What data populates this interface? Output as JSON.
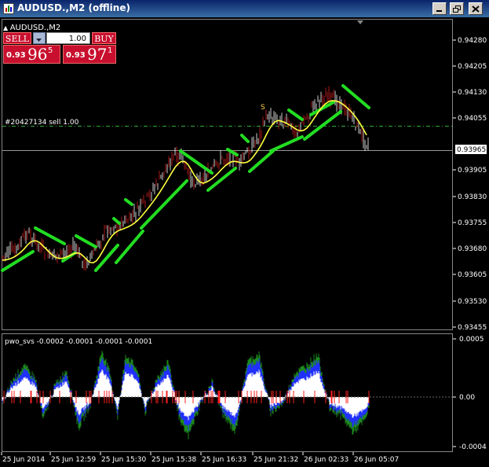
{
  "window": {
    "title": "AUDUSD.,M2 (offline)"
  },
  "chart": {
    "symbol_label": "AUDUSD.,M2",
    "order_line_label": "#20427134 sell 1.00",
    "signal_label": "S",
    "current_price": "0.93965",
    "price_axis": [
      "0.94280",
      "0.94205",
      "0.94130",
      "0.94055",
      "0.93980",
      "0.93905",
      "0.93830",
      "0.93755",
      "0.93680",
      "0.93605",
      "0.93530",
      "0.93455"
    ],
    "time_axis": [
      "25 Jun 2014",
      "25 Jun 12:59",
      "25 Jun 15:30",
      "25 Jun 15:38",
      "25 Jun 16:33",
      "25 Jun 21:32",
      "26 Jun 02:33",
      "26 Jun 05:07"
    ]
  },
  "trade_panel": {
    "sell_label": "SELL",
    "buy_label": "BUY",
    "lot_value": "1.00",
    "sell_price": {
      "prefix": "0.93",
      "big": "96",
      "sup": "5"
    },
    "buy_price": {
      "prefix": "0.93",
      "big": "97",
      "sup": "1"
    }
  },
  "indicator": {
    "label": "pwo_svs -0.0002 -0.0001 -0.0001 -0.0001",
    "axis": [
      "0.0005",
      "0.00",
      "-0.0004"
    ]
  },
  "colors": {
    "candle_bull": "#ffffff",
    "candle_bear": "#d42020",
    "ma_line": "#ffff40",
    "trend_line": "#22dd22",
    "order_line": "#33aa33",
    "axis_text": "#ffffff",
    "hist_white": "#ffffff",
    "hist_blue": "#2030ff",
    "hist_red": "#ff2020",
    "hist_green": "#1c8a1c"
  }
}
